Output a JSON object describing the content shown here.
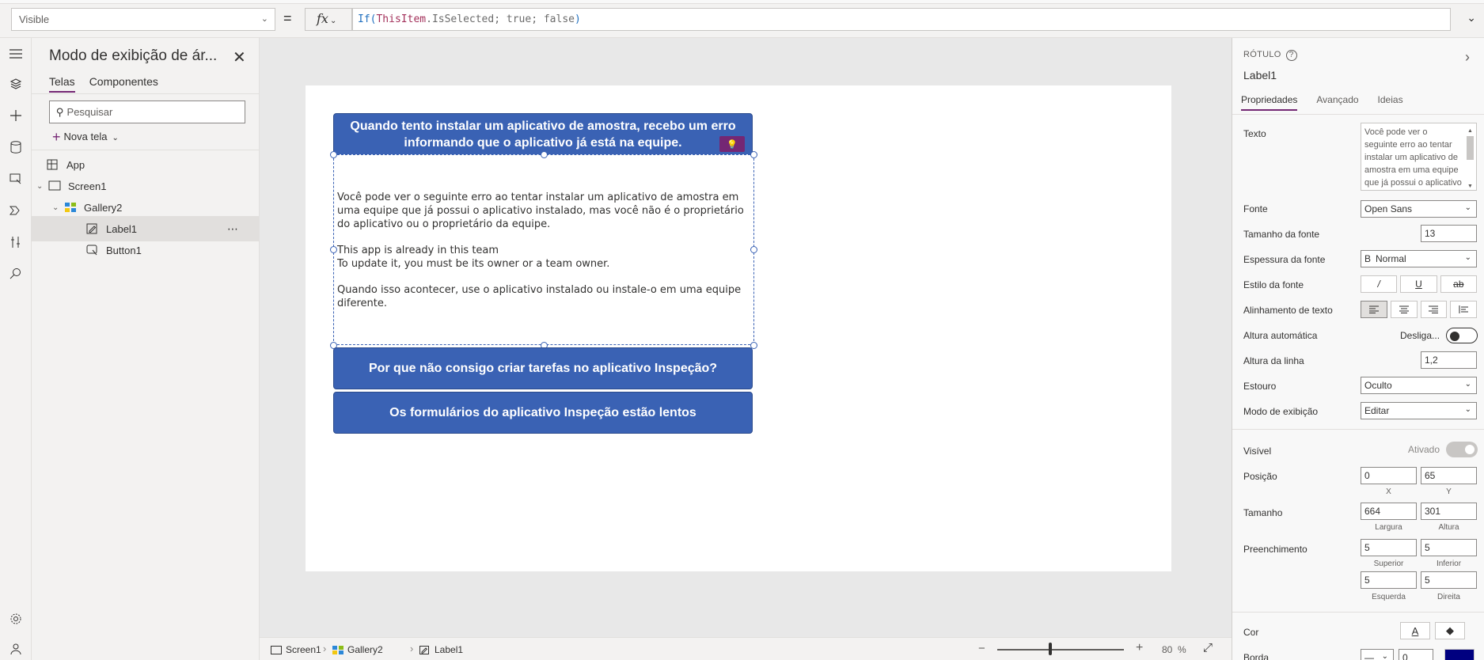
{
  "formula_bar": {
    "property": "Visible",
    "formula_parts": [
      "If(",
      "ThisItem",
      ".",
      "IsSelected",
      "; ",
      "true",
      "; ",
      "false",
      ")"
    ],
    "fx": "fx"
  },
  "tree": {
    "title": "Modo de exibição de ár...",
    "tabs": [
      "Telas",
      "Componentes"
    ],
    "search_placeholder": "Pesquisar",
    "new_screen": "Nova tela",
    "items": [
      {
        "label": "App"
      },
      {
        "label": "Screen1"
      },
      {
        "label": "Gallery2"
      },
      {
        "label": "Label1"
      },
      {
        "label": "Button1"
      }
    ],
    "more": "⋯"
  },
  "canvas": {
    "button1_text": "Quando tento instalar um aplicativo de amostra, recebo um erro informando que o aplicativo já está na equipe.",
    "label_paragraphs": [
      "Você pode ver o seguinte erro ao tentar instalar um aplicativo de amostra em uma equipe que já possui o aplicativo instalado, mas você não é o proprietário do aplicativo ou o proprietário da equipe.",
      "This app is already in this team\nTo update it, you must be its owner or a team owner.",
      "Quando isso acontecer, use o aplicativo instalado ou instale-o em uma equipe diferente."
    ],
    "button2_text": "Por que não consigo criar tarefas no aplicativo Inspeção?",
    "button3_text": "Os formulários do aplicativo Inspeção estão lentos",
    "bulb": "💡"
  },
  "bottom_bar": {
    "breadcrumb": [
      "Screen1",
      "Gallery2",
      "Label1"
    ],
    "zoom_value": "80",
    "zoom_unit": "%",
    "zoom_fraction": 0.42
  },
  "props": {
    "kind": "RÓTULO",
    "name": "Label1",
    "tabs": [
      "Propriedades",
      "Avançado",
      "Ideias"
    ],
    "labels": {
      "text": "Texto",
      "font": "Fonte",
      "font_size": "Tamanho da fonte",
      "font_weight": "Espessura da fonte",
      "font_style": "Estilo da fonte",
      "align": "Alinhamento de texto",
      "auto_height": "Altura automática",
      "line_height": "Altura da linha",
      "overflow": "Estouro",
      "display_mode": "Modo de exibição",
      "visible": "Visível",
      "position": "Posição",
      "size": "Tamanho",
      "padding": "Preenchimento",
      "color": "Cor",
      "border": "Borda"
    },
    "values": {
      "text": "Você pode ver o seguinte erro ao tentar instalar um aplicativo de amostra em uma equipe que já possui o aplicativo instalado",
      "font": "Open Sans",
      "font_size": "13",
      "font_weight_icon": "B",
      "font_weight": "Normal",
      "auto_height": "Desliga...",
      "line_height": "1,2",
      "overflow": "Oculto",
      "display_mode": "Editar",
      "visible": "Ativado",
      "pos_x": "0",
      "pos_y": "65",
      "pos_x_label": "X",
      "pos_y_label": "Y",
      "width": "664",
      "height": "301",
      "width_label": "Largura",
      "height_label": "Altura",
      "pad_top": "5",
      "pad_bottom": "5",
      "pad_top_label": "Superior",
      "pad_bottom_label": "Inferior",
      "pad_left": "5",
      "pad_right": "5",
      "pad_left_label": "Esquerda",
      "pad_right_label": "Direita",
      "border_width": "0"
    },
    "colors": {
      "fill": "#000080",
      "accent": "#742774",
      "button": "#3a62b4"
    }
  }
}
